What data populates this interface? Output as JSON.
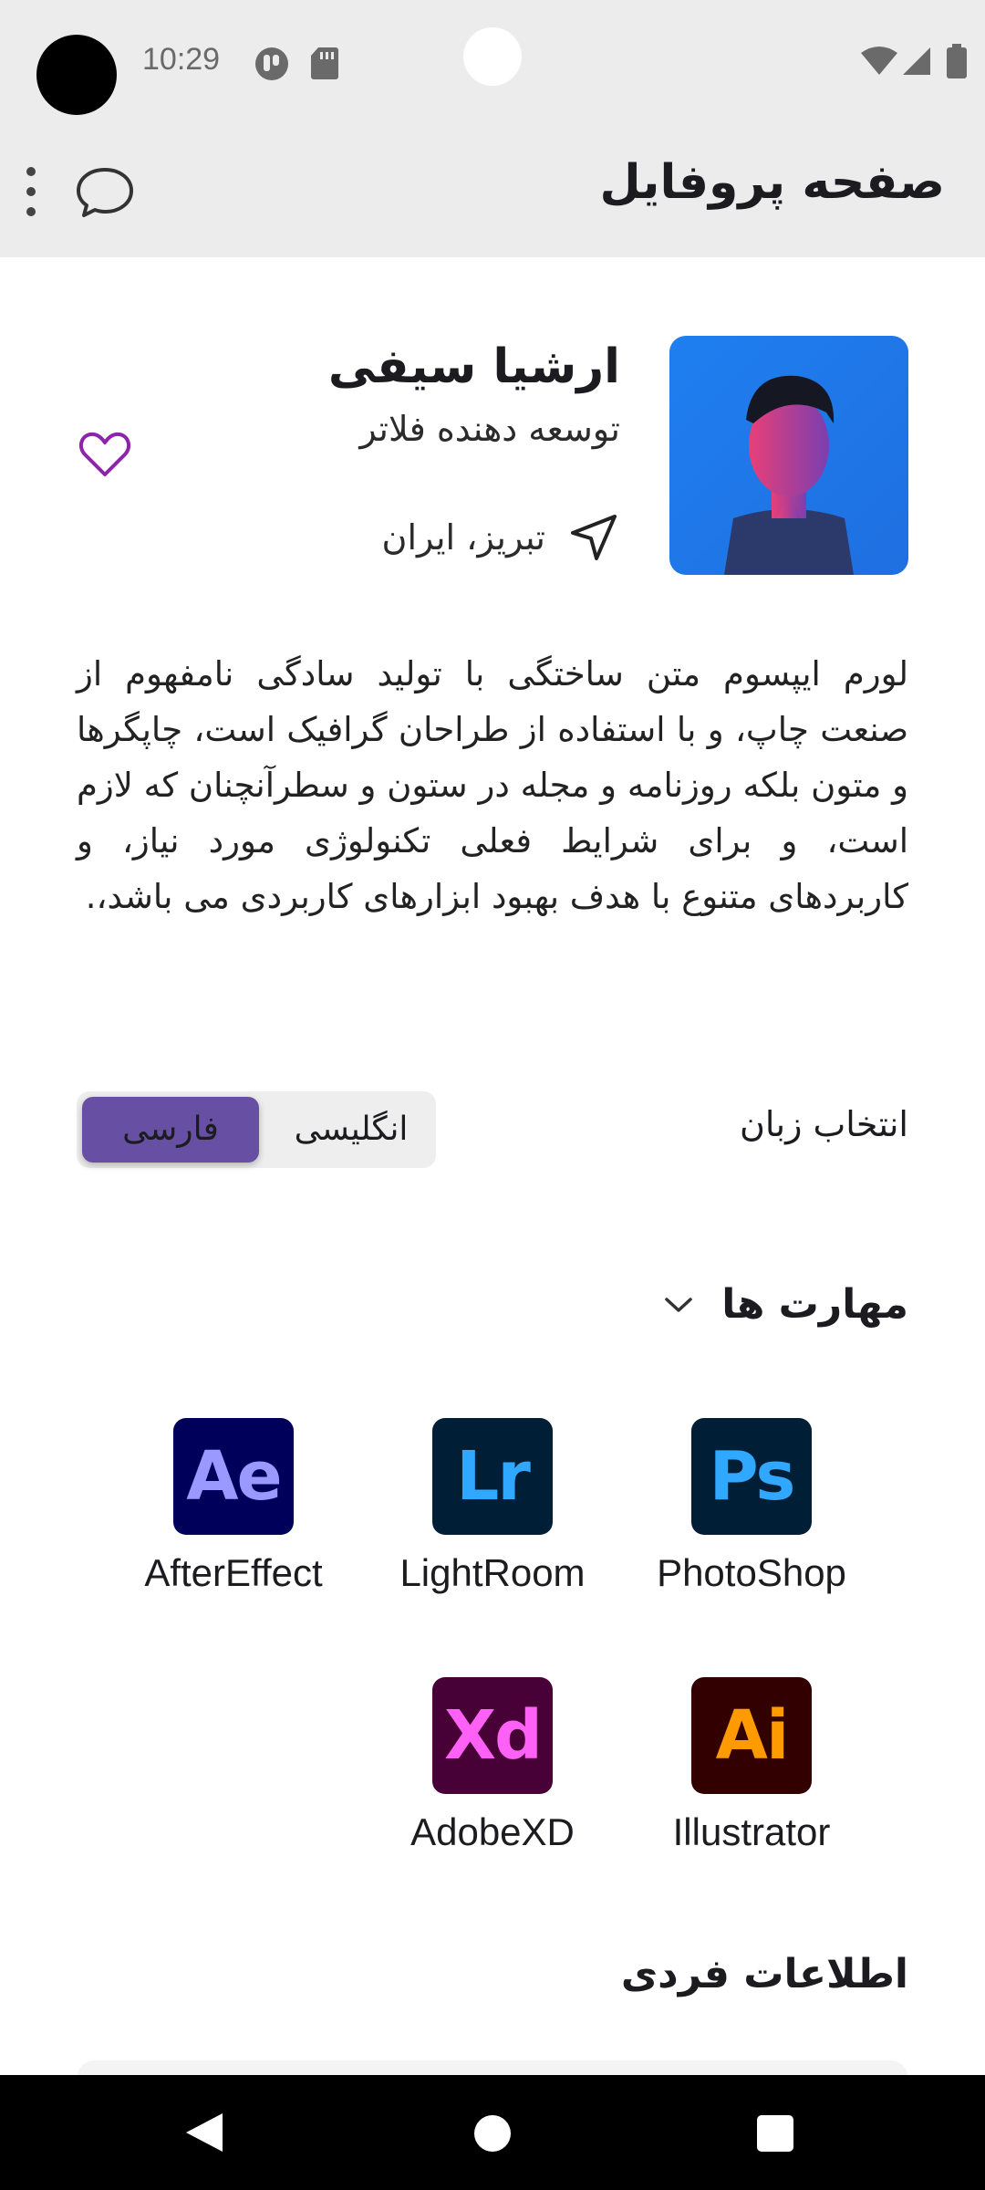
{
  "status_bar": {
    "time": "10:29"
  },
  "app_bar": {
    "title": "صفحه پروفایل"
  },
  "profile": {
    "name": "ارشیا سیفی",
    "role": "توسعه دهنده فلاتر",
    "location": "تبریز، ایران"
  },
  "bio": "لورم ایپسوم متن ساختگی با تولید سادگی نامفهوم از صنعت چاپ، و با استفاده از طراحان گرافیک است، چاپگرها و متون بلکه روزنامه و مجله در ستون و سطرآنچنان که لازم است، و برای شرایط فعلی تکنولوژی مورد نیاز، و کاربردهای متنوع با هدف بهبود ابزارهای کاربردی می باشد،.",
  "language": {
    "label": "انتخاب زبان",
    "options": [
      "انگلیسی",
      "فارسی"
    ],
    "selected": "فارسی"
  },
  "skills": {
    "title": "مهارت ها",
    "items": [
      {
        "abbr": "Ps",
        "label": "PhotoShop",
        "bg": "#001e36",
        "fg": "#31a8ff"
      },
      {
        "abbr": "Lr",
        "label": "LightRoom",
        "bg": "#001e36",
        "fg": "#31a8ff"
      },
      {
        "abbr": "Ae",
        "label": "AfterEffect",
        "bg": "#00005b",
        "fg": "#9999ff"
      },
      {
        "abbr": "Ai",
        "label": "Illustrator",
        "bg": "#330000",
        "fg": "#ff9a00"
      },
      {
        "abbr": "Xd",
        "label": "AdobeXD",
        "bg": "#470137",
        "fg": "#ff61f6"
      }
    ]
  },
  "personal_info": {
    "title": "اطلاعات فردی"
  },
  "colors": {
    "accent": "#6750a4",
    "heart": "#8e24aa",
    "appbar_bg": "#ececec"
  }
}
